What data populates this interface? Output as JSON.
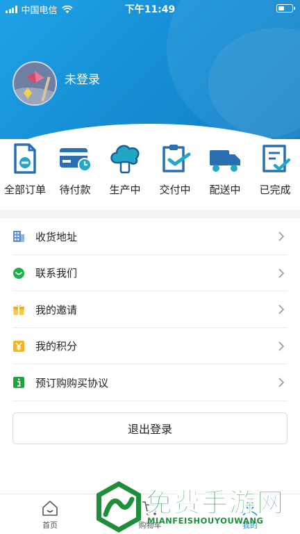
{
  "status_bar": {
    "carrier": "中国电信",
    "time": "下午11:49"
  },
  "profile": {
    "username": "未登录"
  },
  "orders": [
    {
      "label": "全部订单",
      "icon": "all-orders-icon"
    },
    {
      "label": "待付款",
      "icon": "pending-payment-icon"
    },
    {
      "label": "生产中",
      "icon": "in-production-icon"
    },
    {
      "label": "交付中",
      "icon": "delivering-icon"
    },
    {
      "label": "配送中",
      "icon": "shipping-truck-icon"
    },
    {
      "label": "已完成",
      "icon": "completed-icon"
    }
  ],
  "menu": [
    {
      "label": "收货地址",
      "icon": "building-icon"
    },
    {
      "label": "联系我们",
      "icon": "chat-icon"
    },
    {
      "label": "我的邀请",
      "icon": "gift-icon"
    },
    {
      "label": "我的积分",
      "icon": "yen-icon"
    },
    {
      "label": "预订购购买协议",
      "icon": "info-icon"
    }
  ],
  "logout_label": "退出登录",
  "tabbar": {
    "home_label": "首页",
    "cart_label": "购物车",
    "mine_label": "我的"
  },
  "watermark": {
    "title": "免费手游网",
    "subtitle": "MIANFEISHOUYOUWANG"
  },
  "colors": {
    "header_blue": "#1690d6",
    "icon_blue": "#2b6fb3",
    "icon_teal": "#22a7c5",
    "accent_green": "#1d8f3a"
  }
}
